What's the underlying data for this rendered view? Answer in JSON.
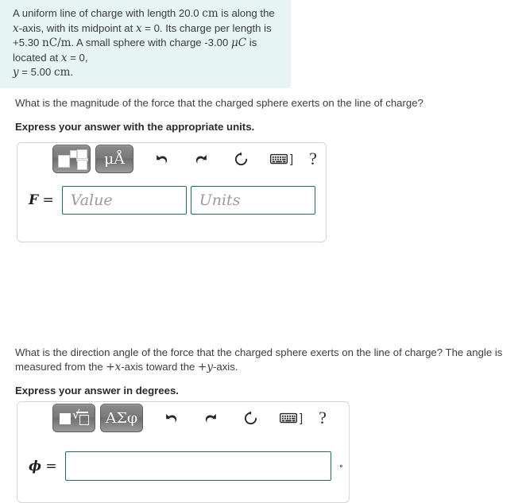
{
  "problem": {
    "line1_a": "A uniform line of charge with length 20.0 ",
    "line1_unit": "cm",
    "line1_b": " is along the ",
    "var_x1": "x",
    "line1_c": "-axis, with its midpoint at ",
    "var_x2": "x",
    "line1_d": " = 0. Its charge per length is +5.30 ",
    "unit_nCm": "nC/m",
    "line1_e": ". A small sphere with charge -3.00 ",
    "unit_uC": "μC",
    "line1_f": " is located at ",
    "var_x3": "x",
    "line1_g": " = 0,",
    "var_y": "y",
    "line1_h": " = 5.00 ",
    "unit_cm2": "cm",
    "line1_i": "."
  },
  "question1": {
    "text_a": "What is the magnitude of the force that the charged sphere exerts on the line of charge?",
    "instruction": "Express your answer with the appropriate units.",
    "toolbar": {
      "template_button": "math-template",
      "units_button": "μÅ",
      "undo_button": "undo",
      "redo_button": "redo",
      "reset_button": "reset",
      "keyboard_button": "keyboard",
      "keyboard_bracket": "]",
      "help_button": "?"
    },
    "var_label": "F",
    "equals": "=",
    "value_placeholder": "Value",
    "units_placeholder": "Units",
    "value": "",
    "units": ""
  },
  "question2": {
    "text_a": "What is the direction angle of the force that the charged sphere exerts on the line of charge? The angle is measured from the ",
    "plus_x": "+x",
    "text_b": "-axis toward the ",
    "plus_y": "+y",
    "text_c": "-axis.",
    "instruction": "Express your answer in degrees.",
    "toolbar": {
      "template_button": "square-root-template",
      "symbols_button": "ΑΣφ",
      "undo_button": "undo",
      "redo_button": "redo",
      "reset_button": "reset",
      "keyboard_button": "keyboard",
      "keyboard_bracket": "]",
      "help_button": "?"
    },
    "var_label": "ϕ",
    "equals": "=",
    "value": "",
    "degree_suffix": "∘"
  },
  "colors": {
    "banner_bg": "#e6f4f2",
    "input_border": "#1d6b6e",
    "box_border": "#d6d6d6",
    "text": "#3d3d3d"
  }
}
